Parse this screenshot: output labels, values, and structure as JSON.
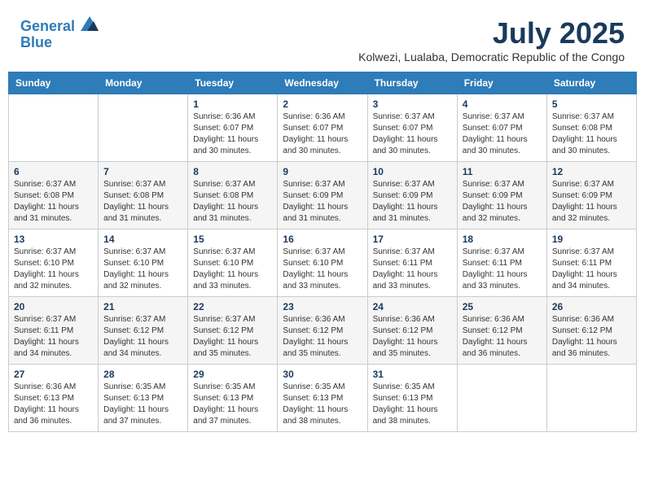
{
  "header": {
    "logo_line1": "General",
    "logo_line2": "Blue",
    "month_year": "July 2025",
    "location": "Kolwezi, Lualaba, Democratic Republic of the Congo"
  },
  "weekdays": [
    "Sunday",
    "Monday",
    "Tuesday",
    "Wednesday",
    "Thursday",
    "Friday",
    "Saturday"
  ],
  "weeks": [
    [
      null,
      null,
      {
        "day": "1",
        "sunrise": "Sunrise: 6:36 AM",
        "sunset": "Sunset: 6:07 PM",
        "daylight": "Daylight: 11 hours and 30 minutes."
      },
      {
        "day": "2",
        "sunrise": "Sunrise: 6:36 AM",
        "sunset": "Sunset: 6:07 PM",
        "daylight": "Daylight: 11 hours and 30 minutes."
      },
      {
        "day": "3",
        "sunrise": "Sunrise: 6:37 AM",
        "sunset": "Sunset: 6:07 PM",
        "daylight": "Daylight: 11 hours and 30 minutes."
      },
      {
        "day": "4",
        "sunrise": "Sunrise: 6:37 AM",
        "sunset": "Sunset: 6:07 PM",
        "daylight": "Daylight: 11 hours and 30 minutes."
      },
      {
        "day": "5",
        "sunrise": "Sunrise: 6:37 AM",
        "sunset": "Sunset: 6:08 PM",
        "daylight": "Daylight: 11 hours and 30 minutes."
      }
    ],
    [
      {
        "day": "6",
        "sunrise": "Sunrise: 6:37 AM",
        "sunset": "Sunset: 6:08 PM",
        "daylight": "Daylight: 11 hours and 31 minutes."
      },
      {
        "day": "7",
        "sunrise": "Sunrise: 6:37 AM",
        "sunset": "Sunset: 6:08 PM",
        "daylight": "Daylight: 11 hours and 31 minutes."
      },
      {
        "day": "8",
        "sunrise": "Sunrise: 6:37 AM",
        "sunset": "Sunset: 6:08 PM",
        "daylight": "Daylight: 11 hours and 31 minutes."
      },
      {
        "day": "9",
        "sunrise": "Sunrise: 6:37 AM",
        "sunset": "Sunset: 6:09 PM",
        "daylight": "Daylight: 11 hours and 31 minutes."
      },
      {
        "day": "10",
        "sunrise": "Sunrise: 6:37 AM",
        "sunset": "Sunset: 6:09 PM",
        "daylight": "Daylight: 11 hours and 31 minutes."
      },
      {
        "day": "11",
        "sunrise": "Sunrise: 6:37 AM",
        "sunset": "Sunset: 6:09 PM",
        "daylight": "Daylight: 11 hours and 32 minutes."
      },
      {
        "day": "12",
        "sunrise": "Sunrise: 6:37 AM",
        "sunset": "Sunset: 6:09 PM",
        "daylight": "Daylight: 11 hours and 32 minutes."
      }
    ],
    [
      {
        "day": "13",
        "sunrise": "Sunrise: 6:37 AM",
        "sunset": "Sunset: 6:10 PM",
        "daylight": "Daylight: 11 hours and 32 minutes."
      },
      {
        "day": "14",
        "sunrise": "Sunrise: 6:37 AM",
        "sunset": "Sunset: 6:10 PM",
        "daylight": "Daylight: 11 hours and 32 minutes."
      },
      {
        "day": "15",
        "sunrise": "Sunrise: 6:37 AM",
        "sunset": "Sunset: 6:10 PM",
        "daylight": "Daylight: 11 hours and 33 minutes."
      },
      {
        "day": "16",
        "sunrise": "Sunrise: 6:37 AM",
        "sunset": "Sunset: 6:10 PM",
        "daylight": "Daylight: 11 hours and 33 minutes."
      },
      {
        "day": "17",
        "sunrise": "Sunrise: 6:37 AM",
        "sunset": "Sunset: 6:11 PM",
        "daylight": "Daylight: 11 hours and 33 minutes."
      },
      {
        "day": "18",
        "sunrise": "Sunrise: 6:37 AM",
        "sunset": "Sunset: 6:11 PM",
        "daylight": "Daylight: 11 hours and 33 minutes."
      },
      {
        "day": "19",
        "sunrise": "Sunrise: 6:37 AM",
        "sunset": "Sunset: 6:11 PM",
        "daylight": "Daylight: 11 hours and 34 minutes."
      }
    ],
    [
      {
        "day": "20",
        "sunrise": "Sunrise: 6:37 AM",
        "sunset": "Sunset: 6:11 PM",
        "daylight": "Daylight: 11 hours and 34 minutes."
      },
      {
        "day": "21",
        "sunrise": "Sunrise: 6:37 AM",
        "sunset": "Sunset: 6:12 PM",
        "daylight": "Daylight: 11 hours and 34 minutes."
      },
      {
        "day": "22",
        "sunrise": "Sunrise: 6:37 AM",
        "sunset": "Sunset: 6:12 PM",
        "daylight": "Daylight: 11 hours and 35 minutes."
      },
      {
        "day": "23",
        "sunrise": "Sunrise: 6:36 AM",
        "sunset": "Sunset: 6:12 PM",
        "daylight": "Daylight: 11 hours and 35 minutes."
      },
      {
        "day": "24",
        "sunrise": "Sunrise: 6:36 AM",
        "sunset": "Sunset: 6:12 PM",
        "daylight": "Daylight: 11 hours and 35 minutes."
      },
      {
        "day": "25",
        "sunrise": "Sunrise: 6:36 AM",
        "sunset": "Sunset: 6:12 PM",
        "daylight": "Daylight: 11 hours and 36 minutes."
      },
      {
        "day": "26",
        "sunrise": "Sunrise: 6:36 AM",
        "sunset": "Sunset: 6:12 PM",
        "daylight": "Daylight: 11 hours and 36 minutes."
      }
    ],
    [
      {
        "day": "27",
        "sunrise": "Sunrise: 6:36 AM",
        "sunset": "Sunset: 6:13 PM",
        "daylight": "Daylight: 11 hours and 36 minutes."
      },
      {
        "day": "28",
        "sunrise": "Sunrise: 6:35 AM",
        "sunset": "Sunset: 6:13 PM",
        "daylight": "Daylight: 11 hours and 37 minutes."
      },
      {
        "day": "29",
        "sunrise": "Sunrise: 6:35 AM",
        "sunset": "Sunset: 6:13 PM",
        "daylight": "Daylight: 11 hours and 37 minutes."
      },
      {
        "day": "30",
        "sunrise": "Sunrise: 6:35 AM",
        "sunset": "Sunset: 6:13 PM",
        "daylight": "Daylight: 11 hours and 38 minutes."
      },
      {
        "day": "31",
        "sunrise": "Sunrise: 6:35 AM",
        "sunset": "Sunset: 6:13 PM",
        "daylight": "Daylight: 11 hours and 38 minutes."
      },
      null,
      null
    ]
  ]
}
